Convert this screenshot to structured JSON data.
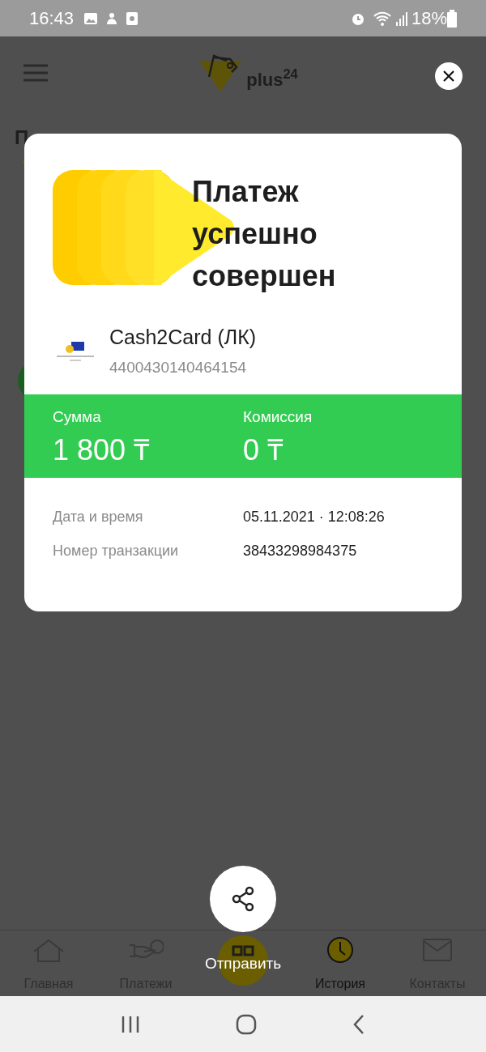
{
  "status_bar": {
    "time": "16:43",
    "battery": "18%"
  },
  "header": {
    "logo": "plus$^{24}$"
  },
  "background": {
    "tab_fragment": "П"
  },
  "dialog": {
    "title": "Платеж успешно совершен",
    "service": "Cash2Card (ЛК)",
    "account": "4400430140464154",
    "amounts": [
      {
        "label": "Сумма",
        "value": "1 800 ₸"
      },
      {
        "label": "Комиссия",
        "value": "0 ₸"
      }
    ],
    "details": [
      {
        "label": "Дата и время",
        "value": "05.11.2021 · 12:08:26"
      },
      {
        "label": "Номер транзакции",
        "value": "38433298984375"
      }
    ]
  },
  "share": {
    "label": "Отправить"
  },
  "bottom_nav": [
    {
      "kind": "home",
      "label": "Главная",
      "selected": false
    },
    {
      "kind": "payments",
      "label": "Платежи",
      "selected": false
    },
    {
      "kind": "qr",
      "selected": false
    },
    {
      "kind": "history",
      "label": "История",
      "selected": true
    },
    {
      "kind": "contacts",
      "label": "Контакты",
      "selected": false
    }
  ]
}
